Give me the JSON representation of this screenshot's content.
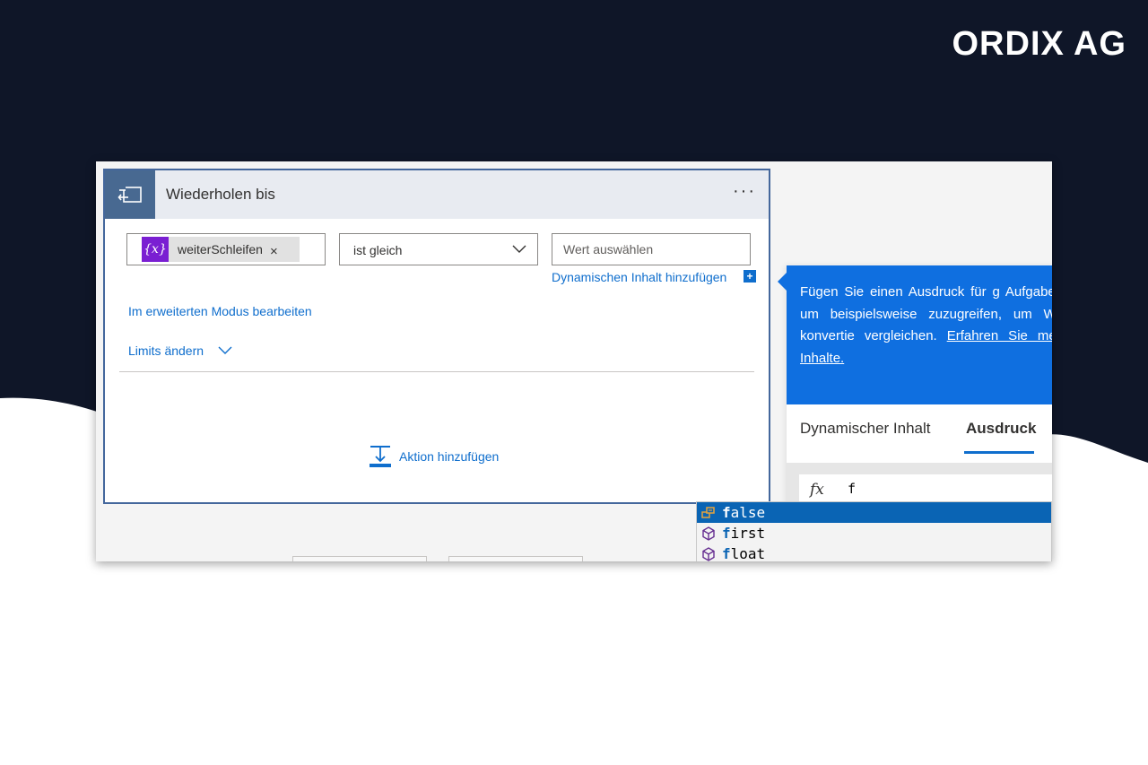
{
  "brand": {
    "name": "ORDIX AG"
  },
  "colors": {
    "dark_bg": "#0f1628",
    "accent_blue": "#0f6ecd",
    "info_blue": "#0f6fe0",
    "token_purple": "#7a1fd2",
    "header_icon_bg": "#486991"
  },
  "card": {
    "title": "Wiederholen bis",
    "more_label": "···",
    "header_icon": "loop-until-icon",
    "condition": {
      "token": {
        "icon_text": "{x}",
        "label": "weiterSchleifen",
        "close": "×"
      },
      "operator": "ist gleich",
      "value_placeholder": "Wert auswählen"
    },
    "dynamic_content_link": "Dynamischen Inhalt hinzufügen",
    "dynamic_plus": "+",
    "advanced_mode_link": "Im erweiterten Modus bearbeiten",
    "limits_link": "Limits ändern",
    "add_action": "Aktion hinzufügen"
  },
  "right_panel": {
    "info_text_1": "Fügen Sie einen Ausdruck für g Aufgaben hinzu, um beispielsweise zuzugreifen, um Werte zu konvertie vergleichen. ",
    "info_link": "Erfahren Sie mehr über Inhalte.",
    "tabs": [
      "Dynamischer Inhalt",
      "Ausdruck"
    ],
    "active_tab": "Ausdruck",
    "fx_label": "fx",
    "expression": "f"
  },
  "autocomplete": {
    "items": [
      {
        "match": "f",
        "rest": "alse",
        "icon": "constant-icon",
        "selected": true
      },
      {
        "match": "f",
        "rest": "irst",
        "icon": "function-cube-icon",
        "selected": false
      },
      {
        "match": "f",
        "rest": "loat",
        "icon": "function-cube-icon",
        "selected": false
      }
    ]
  }
}
